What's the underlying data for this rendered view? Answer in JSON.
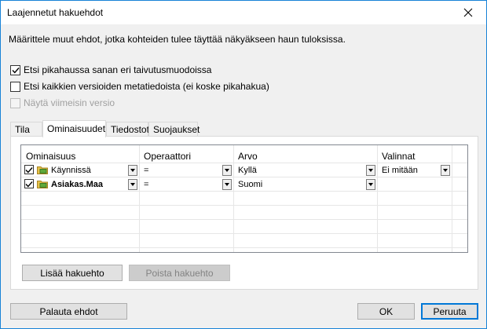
{
  "dialog": {
    "title": "Laajennetut hakuehdot",
    "description": "Määrittele muut ehdot, jotka kohteiden tulee täyttää näkyäkseen haun tuloksissa."
  },
  "options": [
    {
      "label": "Etsi pikahaussa sanan eri taivutusmuodoissa",
      "checked": true,
      "enabled": true
    },
    {
      "label": "Etsi kaikkien versioiden metatiedoista (ei koske pikahakua)",
      "checked": false,
      "enabled": true
    },
    {
      "label": "Näytä viimeisin versio",
      "checked": false,
      "enabled": false
    }
  ],
  "tabs": [
    "Tila",
    "Ominaisuudet",
    "Tiedostot",
    "Suojaukset"
  ],
  "active_tab": "Ominaisuudet",
  "grid": {
    "columns": [
      "Ominaisuus",
      "Operaattori",
      "Arvo",
      "Valinnat"
    ],
    "rows": [
      {
        "property": "Käynnissä",
        "operator": "=",
        "value": "Kyllä",
        "options": "Ei mitään",
        "checked": true,
        "bold": false
      },
      {
        "property": "Asiakas.Maa",
        "operator": "=",
        "value": "Suomi",
        "options": "",
        "checked": true,
        "bold": true
      }
    ]
  },
  "buttons": {
    "add": "Lisää hakuehto",
    "remove": "Poista hakuehto",
    "reset": "Palauta ehdot",
    "ok": "OK",
    "cancel": "Peruuta"
  },
  "colors": {
    "window_border": "#1883d7",
    "dialog_bg": "#f0f0f0",
    "default_button_border": "#0078d7"
  }
}
